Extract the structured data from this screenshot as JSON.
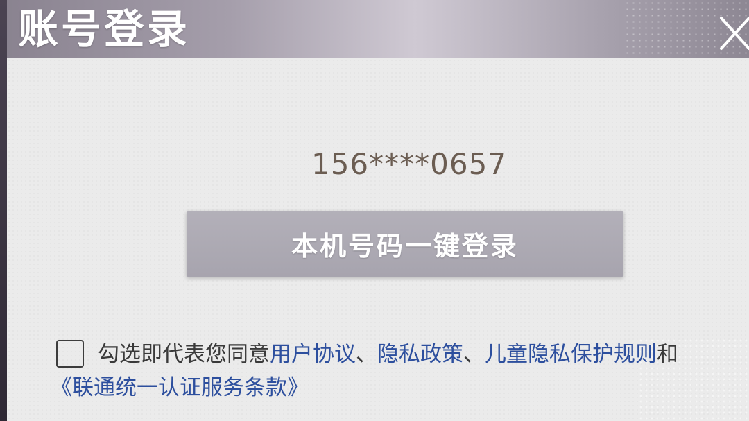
{
  "dialog": {
    "title": "账号登录",
    "close_icon": "close-icon"
  },
  "phone_masked": "156****0657",
  "login_button_label": "本机号码一键登录",
  "agreement": {
    "checked": false,
    "prefix": "勾选即代表您同意",
    "user_agreement": "用户协议",
    "sep1": "、",
    "privacy_policy": "隐私政策",
    "sep2": "、",
    "child_privacy": "儿童隐私保护规则",
    "and": "和",
    "unicom_terms": "《联通统一认证服务条款》"
  },
  "colors": {
    "link": "#2d4f9e",
    "phone_text": "#6b5d52",
    "button_bg": "#aeabb5",
    "panel_bg": "#ebebeb"
  }
}
